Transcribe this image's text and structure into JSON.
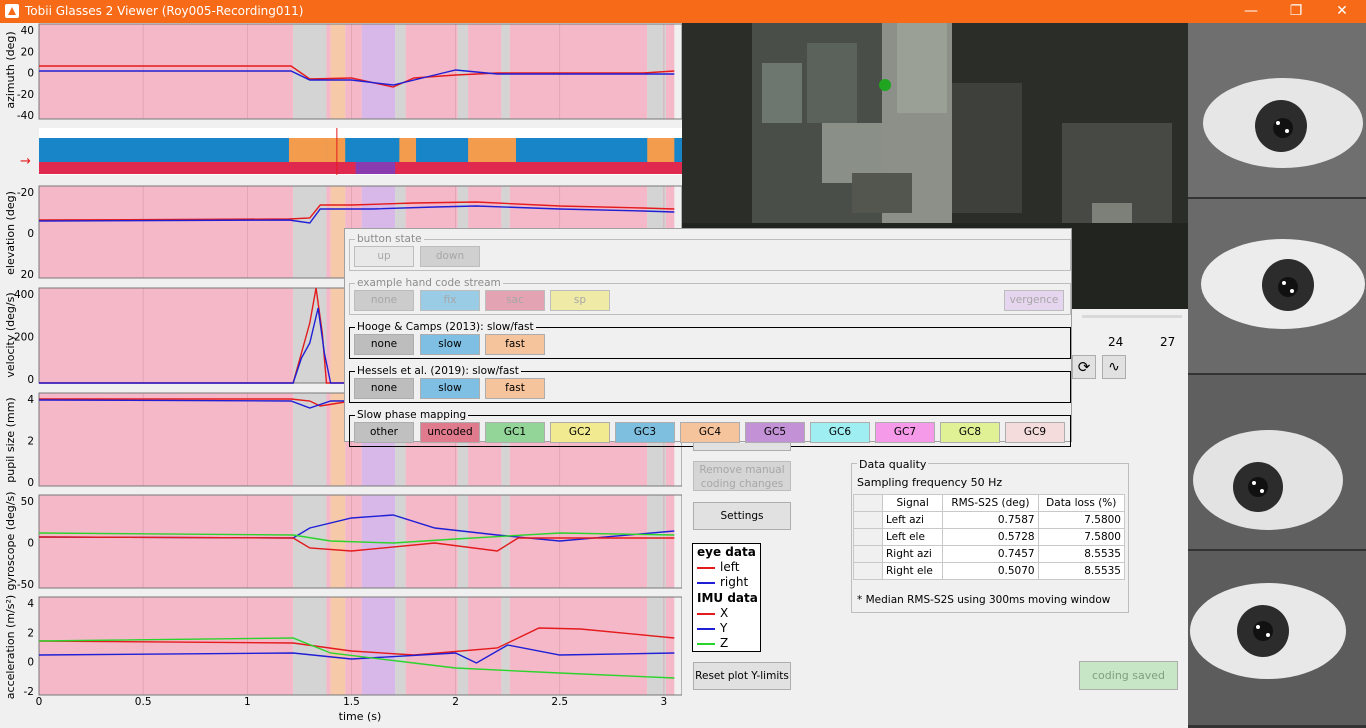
{
  "window": {
    "title": "Tobii Glasses 2 Viewer (Roy005-Recording011)",
    "minimize": "—",
    "maximize": "❐",
    "close": "✕"
  },
  "plots": {
    "xlabel": "time (s)",
    "xticks": [
      "0",
      "0.5",
      "1",
      "1.5",
      "2",
      "2.5",
      "3"
    ],
    "xlim": [
      0,
      3.05
    ],
    "panels": [
      {
        "ylabel": "azimuth (deg)",
        "yticks": [
          "40",
          "20",
          "0",
          "-20",
          "-40"
        ]
      },
      {
        "ylabel": "",
        "marker": "→"
      },
      {
        "ylabel": "elevation (deg)",
        "yticks": [
          "-20",
          "0",
          "20"
        ]
      },
      {
        "ylabel": "velocity (deg/s)",
        "yticks": [
          "400",
          "200",
          "0"
        ]
      },
      {
        "ylabel": "pupil size (mm)",
        "yticks": [
          "4",
          "2",
          "0"
        ]
      },
      {
        "ylabel": "gyroscope (deg/s)",
        "yticks": [
          "50",
          "0",
          "-50"
        ]
      },
      {
        "ylabel": "acceleration (m/s²)",
        "yticks": [
          "4",
          "2",
          "0",
          "-2"
        ]
      }
    ]
  },
  "timeline": {
    "ticks": [
      "24",
      "27"
    ],
    "loop_icon": "loop-icon",
    "wave_icon": "wave-icon"
  },
  "coding_panel": {
    "groups": [
      {
        "title": "button state",
        "buttons": [
          "up",
          "down"
        ]
      },
      {
        "title": "example hand code stream",
        "buttons": [
          "none",
          "fix",
          "sac",
          "sp",
          "vergence"
        ]
      },
      {
        "title": "Hooge & Camps (2013): slow/fast",
        "buttons": [
          "none",
          "slow",
          "fast"
        ]
      },
      {
        "title": "Hessels et al. (2019): slow/fast",
        "buttons": [
          "none",
          "slow",
          "fast"
        ]
      },
      {
        "title": "Slow phase mapping",
        "buttons": [
          "other",
          "uncoded",
          "GC1",
          "GC2",
          "GC3",
          "GC4",
          "GC5",
          "GC6",
          "GC7",
          "GC8",
          "GC9"
        ]
      }
    ]
  },
  "controls": {
    "remove_manual": "Remove manual coding changes",
    "settings": "Settings",
    "reset_ylim": "Reset plot Y-limits",
    "coding_saved": "coding saved"
  },
  "legend": {
    "eye_header": "eye data",
    "eye_items": [
      {
        "label": "left",
        "color": "#e41a1c"
      },
      {
        "label": "right",
        "color": "#1f1fd6"
      }
    ],
    "imu_header": "IMU data",
    "imu_items": [
      {
        "label": "X",
        "color": "#e41a1c"
      },
      {
        "label": "Y",
        "color": "#1f1fd6"
      },
      {
        "label": "Z",
        "color": "#2bd42b"
      }
    ]
  },
  "data_quality": {
    "title": "Data quality",
    "sampling": "Sampling frequency 50 Hz",
    "headers": [
      "Signal",
      "RMS-S2S (deg)",
      "Data loss (%)"
    ],
    "rows": [
      [
        "Left azi",
        "0.7587",
        "7.5800"
      ],
      [
        "Left ele",
        "0.5728",
        "7.5800"
      ],
      [
        "Right azi",
        "0.7457",
        "8.5535"
      ],
      [
        "Right ele",
        "0.5070",
        "8.5535"
      ]
    ],
    "footnote": "* Median RMS-S2S using 300ms moving window"
  },
  "colors": {
    "pink": "#f4b8c8",
    "gray": "#d4d4d4",
    "orange": "#f6c9a8",
    "purple": "#d8b8e8",
    "left": "#e41a1c",
    "right": "#1f1fd6",
    "z": "#2bd42b"
  }
}
